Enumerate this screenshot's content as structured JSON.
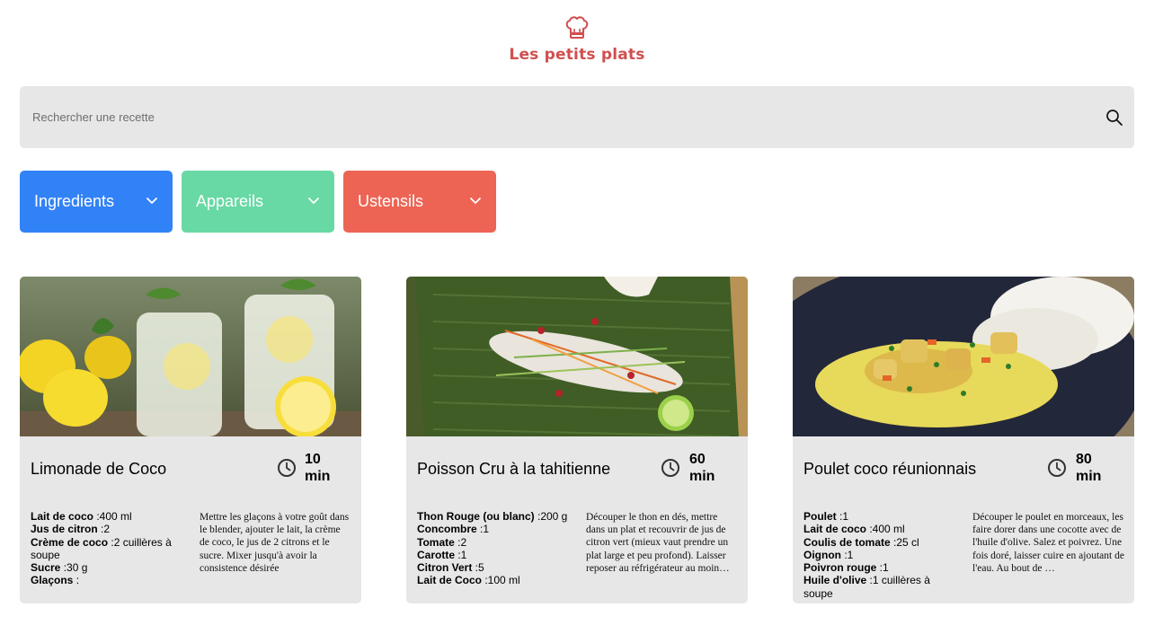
{
  "header": {
    "logo_icon": "chef-hat-icon",
    "title": "Les petits plats",
    "brand_color": "#D04F4F"
  },
  "search": {
    "placeholder": "Rechercher une recette",
    "value": "",
    "icon": "search-icon"
  },
  "filters": [
    {
      "label": "Ingredients",
      "color": "#3282F7",
      "icon": "chevron-down-icon"
    },
    {
      "label": "Appareils",
      "color": "#68D9A4",
      "icon": "chevron-down-icon"
    },
    {
      "label": "Ustensils",
      "color": "#ED6454",
      "icon": "chevron-down-icon"
    }
  ],
  "recipes": [
    {
      "name": "Limonade de Coco",
      "time": "10",
      "time_unit": "min",
      "image": "lemonade-jars-photo",
      "ingredients": [
        {
          "name": "Lait de coco",
          "qty": " :400 ml"
        },
        {
          "name": "Jus de citron",
          "qty": " :2"
        },
        {
          "name": "Crème de coco",
          "qty": " :2 cuillères à soupe"
        },
        {
          "name": "Sucre",
          "qty": " :30 g"
        },
        {
          "name": "Glaçons",
          "qty": " :"
        }
      ],
      "description": "Mettre les glaçons à votre goût dans le blender, ajouter le lait, la crème de coco, le jus de 2 citrons et le sucre. Mixer jusqu'à avoir la consistence désirée"
    },
    {
      "name": "Poisson Cru à la tahitienne",
      "time": "60",
      "time_unit": "min",
      "image": "raw-fish-on-banana-leaf-photo",
      "ingredients": [
        {
          "name": "Thon Rouge (ou blanc)",
          "qty": " :200 g"
        },
        {
          "name": "Concombre",
          "qty": " :1"
        },
        {
          "name": "Tomate",
          "qty": " :2"
        },
        {
          "name": "Carotte",
          "qty": " :1"
        },
        {
          "name": "Citron Vert",
          "qty": " :5"
        },
        {
          "name": "Lait de Coco",
          "qty": " :100 ml"
        }
      ],
      "description": "Découper le thon en dés, mettre dans un plat et recouvrir de jus de citron vert (mieux vaut prendre un plat large et peu profond). Laisser reposer au réfrigérateur au moin…"
    },
    {
      "name": "Poulet coco réunionnais",
      "time": "80",
      "time_unit": "min",
      "image": "chicken-curry-with-rice-photo",
      "ingredients": [
        {
          "name": "Poulet",
          "qty": " :1"
        },
        {
          "name": "Lait de coco",
          "qty": " :400 ml"
        },
        {
          "name": "Coulis de tomate",
          "qty": " :25 cl"
        },
        {
          "name": "Oignon",
          "qty": " :1"
        },
        {
          "name": "Poivron rouge",
          "qty": " :1"
        },
        {
          "name": "Huile d'olive",
          "qty": " :1 cuillères à soupe"
        }
      ],
      "description": "Découper le poulet en morceaux, les faire dorer dans une cocotte avec de l'huile d'olive. Salez et poivrez. Une fois doré, laisser cuire en ajoutant de l'eau. Au bout de …"
    }
  ]
}
